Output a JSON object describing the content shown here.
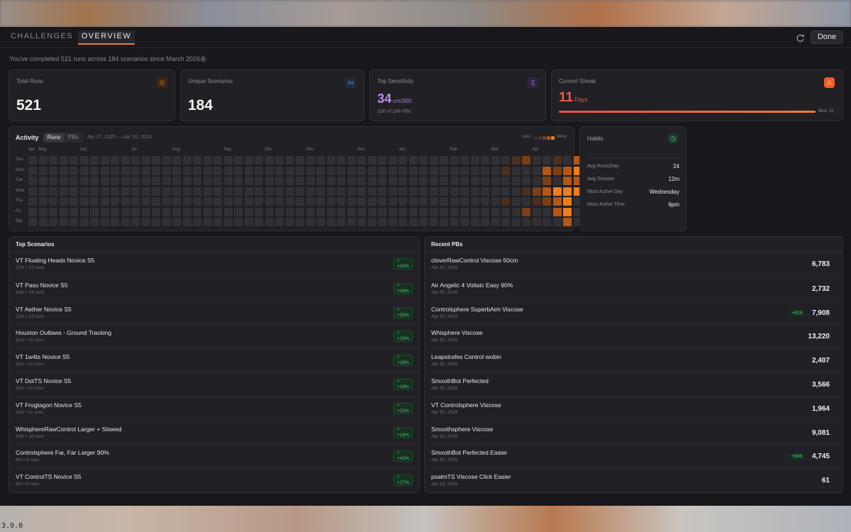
{
  "version": "3.9.0",
  "tabs": [
    "CHALLENGES",
    "OVERVIEW"
  ],
  "header": {
    "done_label": "Done",
    "refresh_icon": "refresh-icon"
  },
  "summary": "You've completed 521 runs across 184 scenarios since March 2026",
  "stats": {
    "total_runs": {
      "label": "Total Runs",
      "value": "521"
    },
    "unique_scenarios": {
      "label": "Unique Scenarios",
      "value": "184"
    },
    "top_sensitivity": {
      "label": "Top Sensitivity",
      "value": "34",
      "unit": "cm/360",
      "sub": "100 of 184 PBs"
    },
    "current_streak": {
      "label": "Current Streak",
      "value": "11",
      "unit": "Days",
      "best": "Best: 11",
      "progress": 1.0
    }
  },
  "activity": {
    "title": "Activity",
    "toggle": [
      "Runs",
      "PBs"
    ],
    "range": "Apr 27, 2025 — Apr 30, 2026",
    "legend_less": "Less",
    "legend_more": "More",
    "colors": [
      "#313035",
      "#4b2f21",
      "#7a3f17",
      "#b45714",
      "#f07d1a"
    ],
    "months": [
      "Apr",
      "May",
      "Jun",
      "Jul",
      "Aug",
      "Sep",
      "Oct",
      "Nov",
      "Dec",
      "Jan",
      "Feb",
      "Mar",
      "Apr"
    ],
    "days": [
      "Sun",
      "Mon",
      "Tue",
      "Wed",
      "Thu",
      "Fri",
      "Sat"
    ],
    "active_cells": [
      {
        "week": 46,
        "day": 1,
        "level": 1
      },
      {
        "week": 46,
        "day": 4,
        "level": 1
      },
      {
        "week": 47,
        "day": 0,
        "level": 1
      },
      {
        "week": 48,
        "day": 0,
        "level": 2
      },
      {
        "week": 48,
        "day": 3,
        "level": 1
      },
      {
        "week": 48,
        "day": 5,
        "level": 2
      },
      {
        "week": 49,
        "day": 3,
        "level": 2
      },
      {
        "week": 49,
        "day": 4,
        "level": 1
      },
      {
        "week": 50,
        "day": 1,
        "level": 3
      },
      {
        "week": 50,
        "day": 2,
        "level": 2
      },
      {
        "week": 50,
        "day": 3,
        "level": 3
      },
      {
        "week": 50,
        "day": 4,
        "level": 2
      },
      {
        "week": 51,
        "day": 0,
        "level": 1
      },
      {
        "week": 51,
        "day": 1,
        "level": 2
      },
      {
        "week": 51,
        "day": 3,
        "level": 4
      },
      {
        "week": 51,
        "day": 4,
        "level": 3
      },
      {
        "week": 51,
        "day": 5,
        "level": 3
      },
      {
        "week": 52,
        "day": 1,
        "level": 3
      },
      {
        "week": 52,
        "day": 2,
        "level": 3
      },
      {
        "week": 52,
        "day": 3,
        "level": 4
      },
      {
        "week": 52,
        "day": 4,
        "level": 4
      },
      {
        "week": 52,
        "day": 5,
        "level": 4
      },
      {
        "week": 52,
        "day": 6,
        "level": 3
      },
      {
        "week": 53,
        "day": 0,
        "level": 3
      },
      {
        "week": 53,
        "day": 1,
        "level": 4
      },
      {
        "week": 53,
        "day": 2,
        "level": 3
      },
      {
        "week": 53,
        "day": 3,
        "level": 4
      }
    ]
  },
  "habits": {
    "title": "Habits",
    "rows": [
      {
        "key": "Avg Runs/Day",
        "value": "24"
      },
      {
        "key": "Avg Session",
        "value": "12m"
      },
      {
        "key": "Most Active Day",
        "value": "Wednesday"
      },
      {
        "key": "Most Active Time",
        "value": "6pm"
      }
    ]
  },
  "top_scenarios": {
    "title": "Top Scenarios",
    "rows": [
      {
        "name": "VT Floating Heads Novice S5",
        "sub": "17m • 17 runs",
        "trend": "+24%"
      },
      {
        "name": "VT Pasu Novice S5",
        "sub": "14m • 14 runs",
        "trend": "+26%"
      },
      {
        "name": "VT Aether Novice S5",
        "sub": "12m • 12 runs",
        "trend": "+33%"
      },
      {
        "name": "Houston Outlaws - Ground Tracking",
        "sub": "11m • 11 runs",
        "trend": "+16%"
      },
      {
        "name": "VT 1w4ts Novice S5",
        "sub": "11m • 11 runs",
        "trend": "+29%"
      },
      {
        "name": "VT DotTS Novice S5",
        "sub": "11m • 11 runs",
        "trend": "+18%"
      },
      {
        "name": "VT Frogtagon Novice S5",
        "sub": "11m • 11 runs",
        "trend": "+22%"
      },
      {
        "name": "WhisphereRawControl Larger + Slowed",
        "sub": "10m • 10 runs",
        "trend": "+19%"
      },
      {
        "name": "Controlsphere Far, Far Larger 90%",
        "sub": "9m • 9 runs",
        "trend": "+41%"
      },
      {
        "name": "VT ControlTS Novice S5",
        "sub": "9m • 9 runs",
        "trend": "+17%"
      }
    ]
  },
  "recent_pbs": {
    "title": "Recent PBs",
    "rows": [
      {
        "name": "cloverRawControl Viscose 50cm",
        "date": "Apr 30, 2026",
        "value": "6,783",
        "delta": ""
      },
      {
        "name": "Air Angelic 4 Voltaic Easy 90%",
        "date": "Apr 30, 2026",
        "value": "2,732",
        "delta": ""
      },
      {
        "name": "Controlsphere SuperbAim Viscose",
        "date": "Apr 30, 2026",
        "value": "7,908",
        "delta": "+819"
      },
      {
        "name": "Whisphere Viscose",
        "date": "Apr 30, 2026",
        "value": "13,220",
        "delta": ""
      },
      {
        "name": "Leapstrafes Control wobin",
        "date": "Apr 30, 2026",
        "value": "2,407",
        "delta": ""
      },
      {
        "name": "SmoothBot Perfected",
        "date": "Apr 30, 2026",
        "value": "3,566",
        "delta": ""
      },
      {
        "name": "VT Controlsphere Viscose",
        "date": "Apr 30, 2026",
        "value": "1,964",
        "delta": ""
      },
      {
        "name": "Smoothsphere Viscose",
        "date": "Apr 30, 2026",
        "value": "9,081",
        "delta": ""
      },
      {
        "name": "SmoothBot Perfected Easier",
        "date": "Apr 30, 2026",
        "value": "4,745",
        "delta": "+606"
      },
      {
        "name": "psalmTS Viscose Click Easier",
        "date": "Apr 29, 2026",
        "value": "61",
        "delta": ""
      }
    ]
  }
}
